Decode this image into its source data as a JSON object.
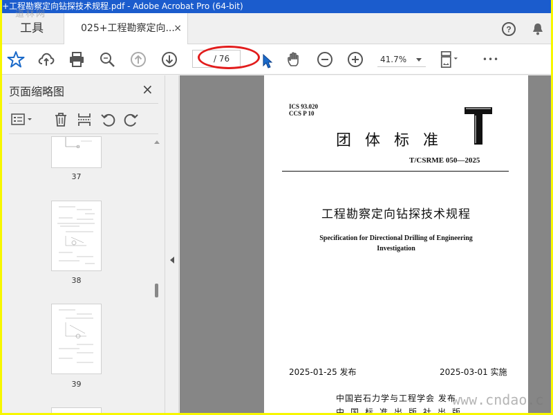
{
  "window": {
    "title": "+工程勘察定向钻探技术规程.pdf - Adobe Acrobat Pro (64-bit)"
  },
  "tabs": {
    "tools_label": "工具",
    "doc_label": "025+工程勘察定向...",
    "close_glyph": "×"
  },
  "toolbar": {
    "page_value": "/ 76",
    "zoom_value": "41.7%",
    "more_glyph": "•••"
  },
  "sidebar": {
    "title": "页面缩略图",
    "close_glyph": "×",
    "thumbnails": [
      {
        "label": "37"
      },
      {
        "label": "38"
      },
      {
        "label": "39"
      }
    ]
  },
  "document": {
    "ics_line": "ICS  93.020",
    "ccs_line": "CCS  P  10",
    "type_title": "团体标准",
    "standard_number": "T/CSRME 050—2025",
    "title_zh": "工程勘察定向钻探技术规程",
    "title_en_line1": "Specification for Directional Drilling of Engineering",
    "title_en_line2": "Investigation",
    "publish_date": "2025-01-25 发布",
    "implement_date": "2025-03-01 实施",
    "issuer_line1": "中国岩石力学与工程学会   发布",
    "issuer_line2": "中国标准出版社出版"
  },
  "watermarks": {
    "bottom_right": "www.cndao.c",
    "top_left": "道林网"
  },
  "colors": {
    "titlebar_bg": "#1b5ccd",
    "highlight_ellipse": "#e21c1c",
    "accent_blue": "#1b6ac9",
    "outer_border": "#f7f700"
  },
  "icons": {
    "toolbar": [
      "star-icon",
      "cloud-upload-icon",
      "print-icon",
      "zoom-search-icon",
      "page-up-icon",
      "page-down-icon",
      "hand-tool-icon",
      "zoom-out-icon",
      "zoom-in-icon",
      "page-fit-icon",
      "more-icon"
    ],
    "sidebar": [
      "thumbnail-options-icon",
      "delete-page-icon",
      "insert-page-icon",
      "rotate-ccw-icon",
      "rotate-cw-icon"
    ]
  }
}
